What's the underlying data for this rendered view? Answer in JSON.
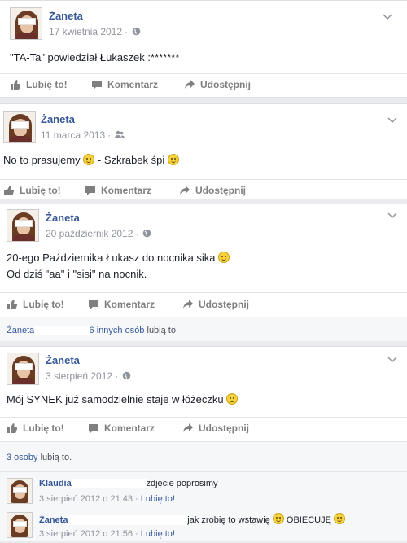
{
  "posts": [
    {
      "author": "Żaneta",
      "date": "17 kwietnia 2012",
      "privacy_icon": "globe-icon",
      "lines": [
        "\"TA-Ta\" powiedział Łukaszek :*******"
      ]
    },
    {
      "author": "Żaneta",
      "date": "11 marca 2013",
      "privacy_icon": "friends-icon",
      "line_a": "No to prasujemy",
      "line_b": "- Szkrabek śpi"
    },
    {
      "author": "Żaneta",
      "date": "20 październik 2012",
      "privacy_icon": "globe-icon",
      "line_1": "20-ego Października Łukasz do nocnika sika",
      "line_2": "Od dziś \"aa\" i \"sisi\" na nocnik.",
      "likes_prefix": "Żaneta",
      "likes_rest": "6 innych osób",
      "likes_suffix": "lubią to."
    },
    {
      "author": "Żaneta",
      "date": "3 sierpień 2012",
      "privacy_icon": "globe-icon",
      "line_1": "Mój SYNEK już samodzielnie staje w łóżeczku",
      "likes_count": "3 osoby",
      "likes_suffix": "lubią to.",
      "comments": [
        {
          "name": "Klaudia",
          "text": "zdjęcie poprosimy",
          "time": "3 sierpień 2012 o 21:43",
          "like": "Lubię to!"
        },
        {
          "name": "Żaneta",
          "text_a": "jak zrobię to wstawię",
          "text_b": "OBIECUJĘ",
          "time": "3 sierpień 2012 o 21:56",
          "like": "Lubię to!"
        }
      ]
    }
  ],
  "actions": {
    "like": "Lubię to!",
    "comment": "Komentarz",
    "share": "Udostępnij"
  },
  "colors": {
    "link": "#365899",
    "muted": "#90949c",
    "action": "#7f7f7f"
  }
}
